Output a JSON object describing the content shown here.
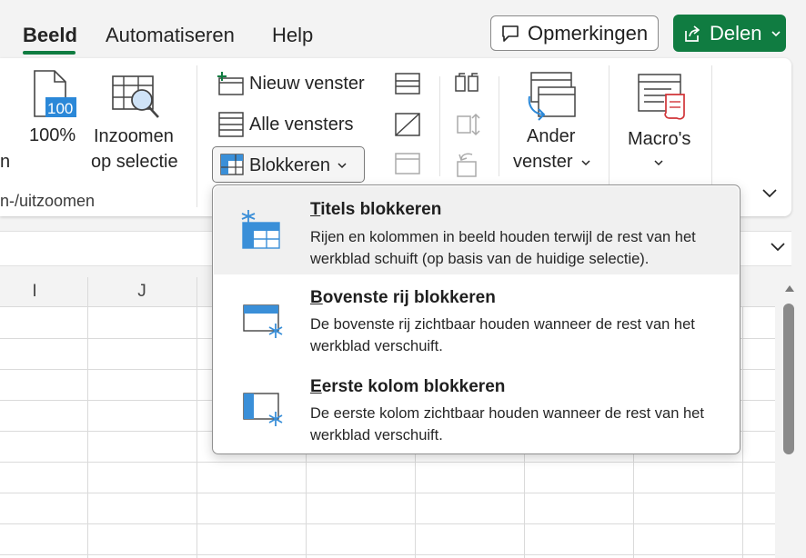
{
  "tabs": [
    {
      "label": "Beeld",
      "active": true
    },
    {
      "label": "Automatiseren",
      "active": false
    },
    {
      "label": "Help",
      "active": false
    }
  ],
  "header": {
    "comments_label": "Opmerkingen",
    "share_label": "Delen"
  },
  "ribbon": {
    "zoom_partial_label": "n",
    "zoom100_label": "100%",
    "zoom100_icon_text": "100",
    "zoom_selection_line1": "Inzoomen",
    "zoom_selection_line2": "op selectie",
    "zoom_group_label": "n-/uitzoomen",
    "new_window_label": "Nieuw venster",
    "all_windows_label": "Alle vensters",
    "freeze_label": "Blokkeren",
    "switch_window_line1": "Ander",
    "switch_window_line2": "venster",
    "macros_label": "Macro's"
  },
  "columns": [
    "I",
    "J"
  ],
  "freeze_menu": {
    "items": [
      {
        "title_first": "T",
        "title_rest": "itels blokkeren",
        "description": "Rijen en kolommen in beeld houden terwijl de rest van het werkblad schuift (op basis van de huidige selectie)."
      },
      {
        "title_first": "B",
        "title_rest": "ovenste rij blokkeren",
        "description": "De bovenste rij zichtbaar houden wanneer de rest van het werkblad verschuift."
      },
      {
        "title_first": "E",
        "title_rest": "erste kolom blokkeren",
        "description": "De eerste kolom zichtbaar houden wanneer de rest van het werkblad verschuift."
      }
    ]
  },
  "colors": {
    "accent_green": "#107c41",
    "icon_blue": "#3a8fd8"
  }
}
